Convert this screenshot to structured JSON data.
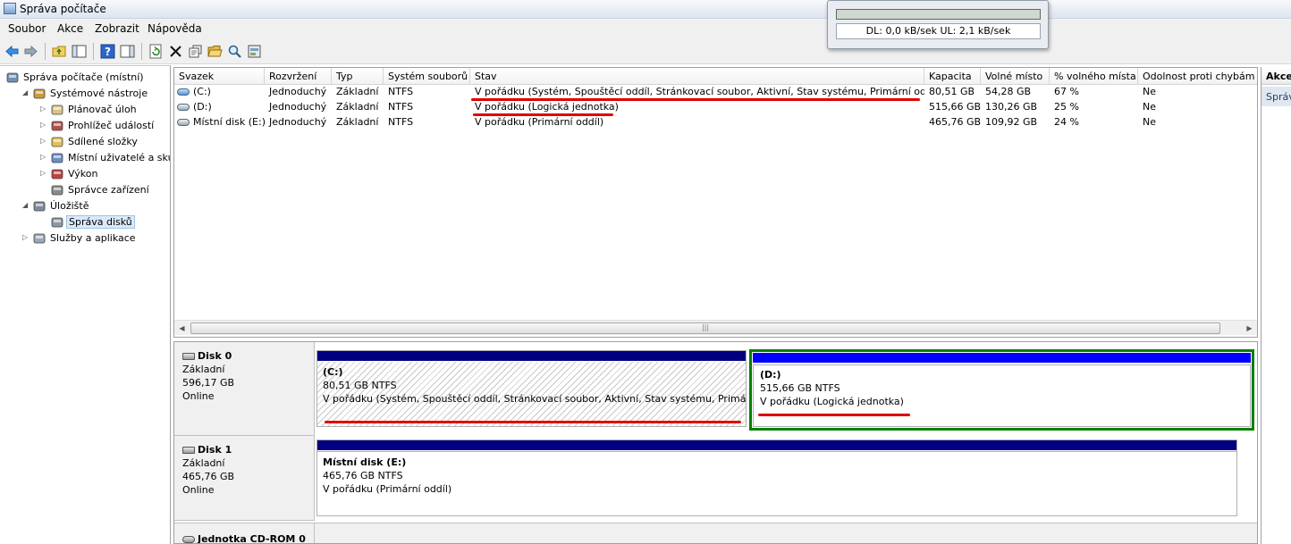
{
  "window": {
    "title": "Správa počítače"
  },
  "menu": [
    "Soubor",
    "Akce",
    "Zobrazit",
    "Nápověda"
  ],
  "overlay": {
    "transfer": "DL: 0,0 kB/sek  UL: 2,1 kB/sek"
  },
  "tree": [
    {
      "label": "Správa počítače (místní)",
      "icon": "computer-icon",
      "level": 0,
      "expander": ""
    },
    {
      "label": "Systémové nástroje",
      "icon": "tools-icon",
      "level": 1,
      "expander": "expanded"
    },
    {
      "label": "Plánovač úloh",
      "icon": "clock-icon",
      "level": 2,
      "expander": "collapsed"
    },
    {
      "label": "Prohlížeč událostí",
      "icon": "event-viewer-icon",
      "level": 2,
      "expander": "collapsed"
    },
    {
      "label": "Sdílené složky",
      "icon": "shared-folder-icon",
      "level": 2,
      "expander": "collapsed"
    },
    {
      "label": "Místní uživatelé a skupiny",
      "icon": "users-icon",
      "level": 2,
      "expander": "collapsed"
    },
    {
      "label": "Výkon",
      "icon": "performance-icon",
      "level": 2,
      "expander": "collapsed"
    },
    {
      "label": "Správce zařízení",
      "icon": "device-manager-icon",
      "level": 2,
      "expander": ""
    },
    {
      "label": "Úložiště",
      "icon": "storage-icon",
      "level": 1,
      "expander": "expanded"
    },
    {
      "label": "Správa disků",
      "icon": "disk-management-icon",
      "level": 2,
      "expander": "",
      "selected": true
    },
    {
      "label": "Služby a aplikace",
      "icon": "services-icon",
      "level": 1,
      "expander": "collapsed"
    }
  ],
  "volumes": {
    "columns": [
      "Svazek",
      "Rozvržení",
      "Typ",
      "Systém souborů",
      "Stav",
      "Kapacita",
      "Volné místo",
      "% volného místa",
      "Odolnost proti chybám"
    ],
    "rows": [
      [
        "(C:)",
        "Jednoduchý",
        "Základní",
        "NTFS",
        "V pořádku (Systém, Spouštěcí oddíl, Stránkovací soubor, Aktivní, Stav systému, Primární oddíl)",
        "80,51 GB",
        "54,28 GB",
        "67 %",
        "Ne"
      ],
      [
        "(D:)",
        "Jednoduchý",
        "Základní",
        "NTFS",
        "V pořádku (Logická jednotka)",
        "515,66 GB",
        "130,26 GB",
        "25 %",
        "Ne"
      ],
      [
        "Místní disk (E:)",
        "Jednoduchý",
        "Základní",
        "NTFS",
        "V pořádku (Primární oddíl)",
        "465,76 GB",
        "109,92 GB",
        "24 %",
        "Ne"
      ]
    ]
  },
  "disks": [
    {
      "name": "Disk 0",
      "type": "Základní",
      "size": "596,17 GB",
      "status": "Online",
      "partitions": [
        {
          "label": "(C:)",
          "fs": "80,51 GB NTFS",
          "status": "V pořádku (Systém, Spouštěcí oddíl, Stránkovací soubor, Aktivní, Stav systému, Primární oddíl)"
        },
        {
          "label": "(D:)",
          "fs": "515,66 GB NTFS",
          "status": "V pořádku (Logická jednotka)"
        }
      ]
    },
    {
      "name": "Disk 1",
      "type": "Základní",
      "size": "465,76 GB",
      "status": "Online",
      "partitions": [
        {
          "label": "Místní disk  (E:)",
          "fs": "465,76 GB NTFS",
          "status": "V pořádku (Primární oddíl)"
        }
      ]
    },
    {
      "name": "Jednotka CD-ROM 0"
    }
  ],
  "actions": {
    "title": "Akce",
    "item": "Správa disků"
  },
  "colors": {
    "primary_bar": "#000080",
    "logical_bar": "#0000ff",
    "selection": "#008000",
    "annotation": "#e00000"
  }
}
